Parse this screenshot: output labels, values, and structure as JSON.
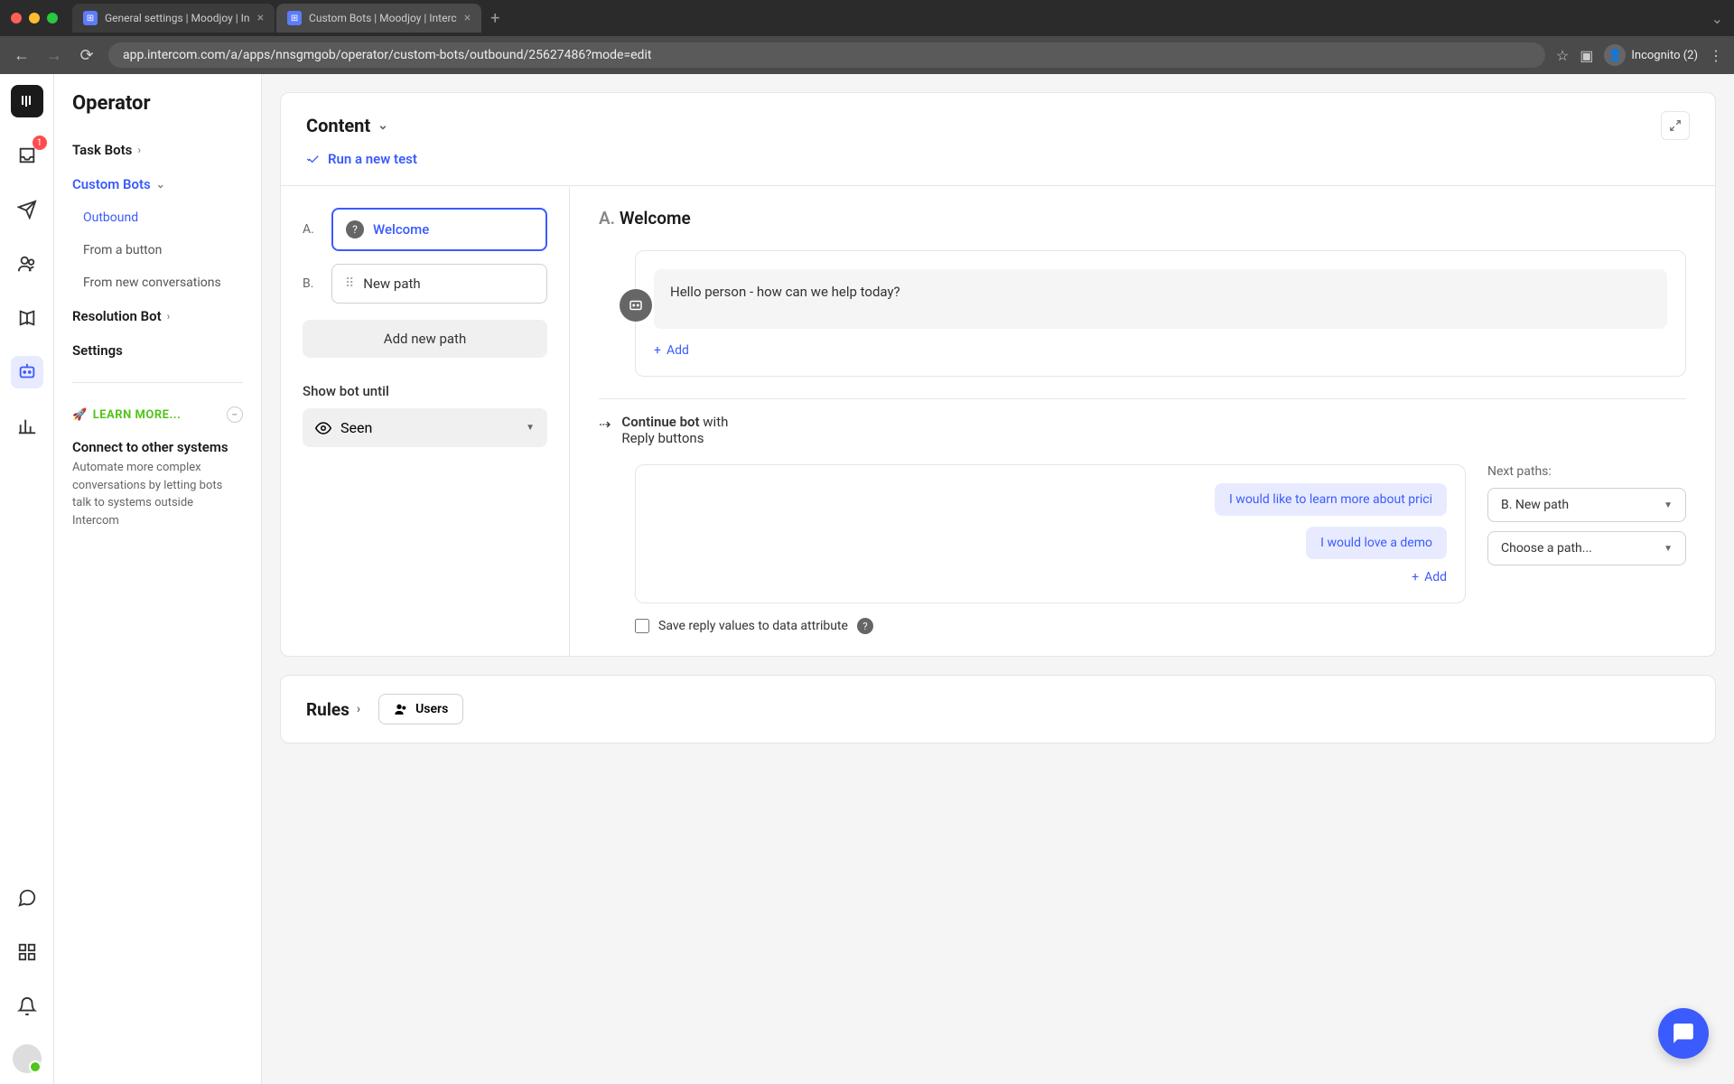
{
  "browser": {
    "tabs": [
      {
        "title": "General settings | Moodjoy | In"
      },
      {
        "title": "Custom Bots | Moodjoy | Interc"
      }
    ],
    "url": "app.intercom.com/a/apps/nnsgmgob/operator/custom-bots/outbound/25627486?mode=edit",
    "incognito": "Incognito (2)"
  },
  "rail": {
    "inbox_badge": "1"
  },
  "sidebar": {
    "title": "Operator",
    "nav": {
      "task_bots": "Task Bots",
      "custom_bots": "Custom Bots",
      "outbound": "Outbound",
      "from_button": "From a button",
      "from_new": "From new conversations",
      "resolution_bot": "Resolution Bot",
      "settings": "Settings"
    },
    "learn_more": "LEARN MORE...",
    "connect": {
      "title": "Connect to other systems",
      "desc": "Automate more complex conversations by letting bots talk to systems outside Intercom"
    }
  },
  "main": {
    "content_title": "Content",
    "run_test": "Run a new test",
    "paths": [
      {
        "letter": "A.",
        "name": "Welcome"
      },
      {
        "letter": "B.",
        "name": "New path"
      }
    ],
    "add_path": "Add new path",
    "show_until_label": "Show bot until",
    "show_until_value": "Seen",
    "detail": {
      "letter": "A.",
      "name": "Welcome",
      "message": "Hello person - how can we help today?",
      "add": "Add",
      "continue_strong": "Continue bot",
      "continue_with": "with",
      "continue_sub": "Reply buttons",
      "replies": [
        "I would like to learn more about prici",
        "I would love a demo"
      ],
      "next_paths_label": "Next paths:",
      "next_paths": [
        "B. New path",
        "Choose a path..."
      ],
      "add_reply": "Add",
      "save_label": "Save reply values to data attribute"
    },
    "rules_title": "Rules",
    "users_chip": "Users"
  }
}
